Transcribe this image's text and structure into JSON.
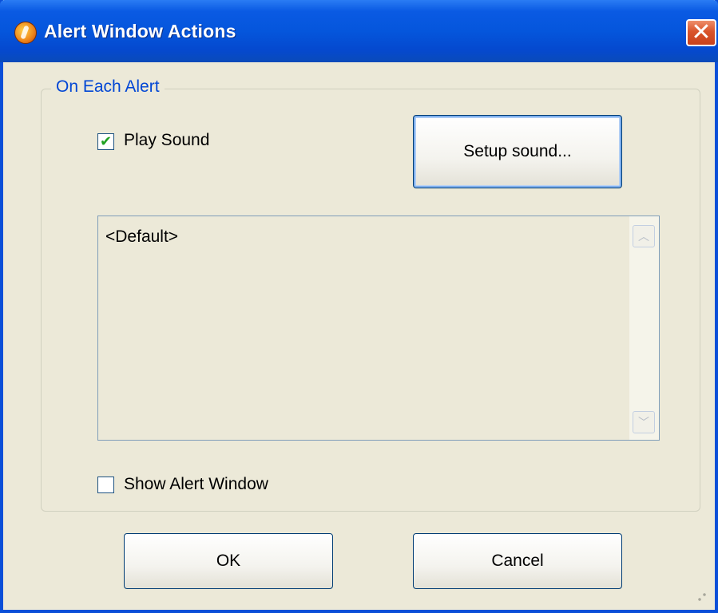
{
  "window": {
    "title": "Alert Window Actions",
    "close_glyph": "✕",
    "app_icon": "app-icon"
  },
  "group": {
    "legend": "On Each Alert",
    "play_sound": {
      "label": "Play Sound",
      "checked": true
    },
    "setup_sound_label": "Setup sound...",
    "sound_list": [
      "<Default>"
    ],
    "show_alert_window": {
      "label": "Show Alert Window",
      "checked": false
    }
  },
  "buttons": {
    "ok_label": "OK",
    "cancel_label": "Cancel"
  },
  "colors": {
    "titlebar": "#0556dc",
    "legend_text": "#0046d5",
    "check_tick": "#21a121",
    "close_button": "#d9542b"
  }
}
